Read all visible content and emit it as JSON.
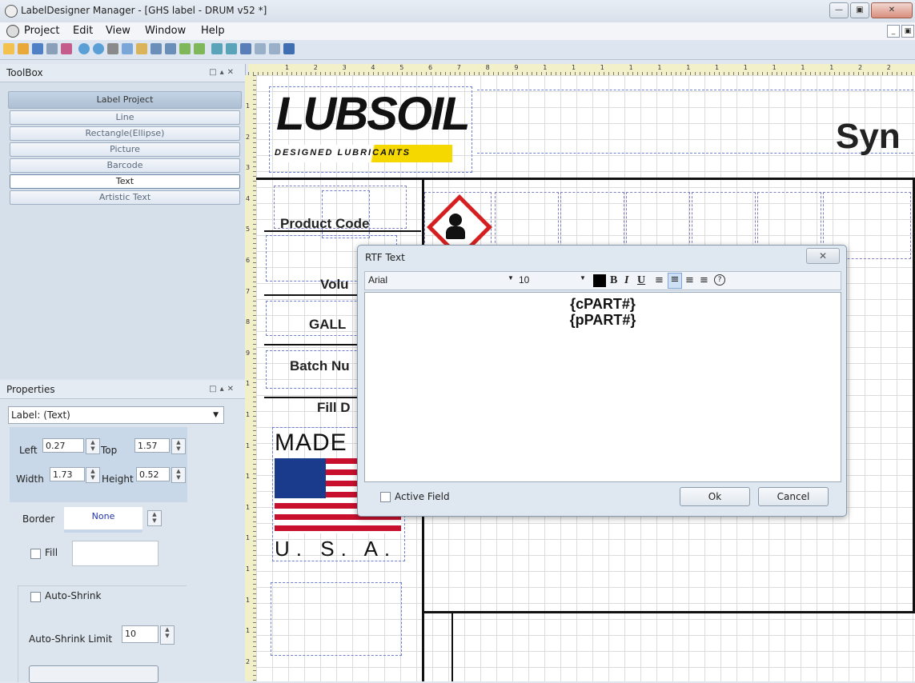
{
  "window": {
    "title": "LabelDesigner Manager - [GHS label - DRUM v52 *]"
  },
  "menu": {
    "items": [
      "Project",
      "Edit",
      "View",
      "Window",
      "Help"
    ]
  },
  "toolbox": {
    "title": "ToolBox",
    "header": "Label Project",
    "items": [
      "Line",
      "Rectangle(Ellipse)",
      "Picture",
      "Barcode",
      "Text",
      "Artistic Text"
    ],
    "selected": "Text"
  },
  "properties": {
    "title": "Properties",
    "selector": "Label: (Text)",
    "left_label": "Left",
    "left_value": "0.27",
    "top_label": "Top",
    "top_value": "1.57",
    "width_label": "Width",
    "width_value": "1.73",
    "height_label": "Height",
    "height_value": "0.52",
    "border_label": "Border",
    "border_value": "None",
    "fill_label": "Fill",
    "autoshrink_label": "Auto-Shrink",
    "autoshrink_limit_label": "Auto-Shrink Limit",
    "autoshrink_limit_value": "10"
  },
  "ruler": {
    "top": [
      "1",
      "2",
      "3",
      "4",
      "5",
      "6",
      "7",
      "8",
      "9",
      "1",
      "1",
      "1",
      "1",
      "1",
      "1",
      "1",
      "1",
      "1",
      "1",
      "1",
      "2",
      "2",
      "2"
    ],
    "left": [
      "1",
      "2",
      "3",
      "4",
      "5",
      "6",
      "7",
      "8",
      "9",
      "1",
      "1",
      "1",
      "1",
      "1",
      "1",
      "1",
      "1",
      "1",
      "2"
    ]
  },
  "label": {
    "logo_main": "LUBSOIL",
    "logo_sub": "DESIGNED LUBRICANTS",
    "title_partial": "Syn",
    "product_code": "Product Code",
    "volume": "Volu",
    "gallons": "GALL",
    "batch": "Batch Nu",
    "fill_date": "Fill D",
    "made": "MADE",
    "usa": "U. S. A."
  },
  "dialog": {
    "title": "RTF Text",
    "font": "Arial",
    "size": "10",
    "bold": "B",
    "italic": "I",
    "underline": "U",
    "lines": [
      "{cPART#}",
      "{pPART#}"
    ],
    "active_field_label": "Active Field",
    "ok_label": "Ok",
    "cancel_label": "Cancel"
  },
  "colors": {
    "ghs_red": "#d42020",
    "logo_yellow": "#f5d800"
  }
}
